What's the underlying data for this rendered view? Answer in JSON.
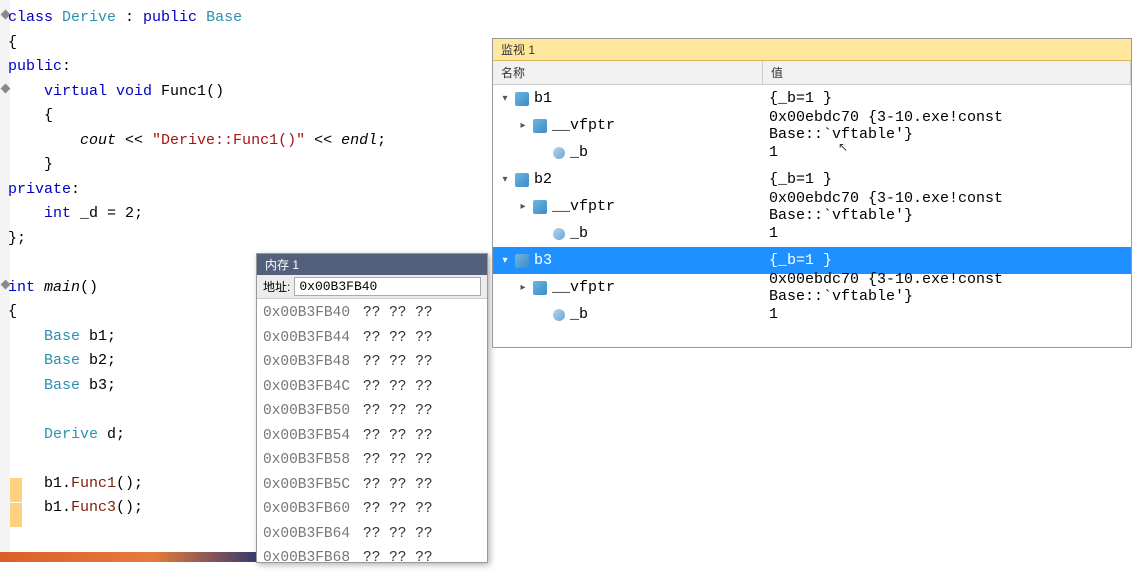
{
  "code": {
    "lines": [
      {
        "seg": [
          {
            "t": "class ",
            "c": "kw"
          },
          {
            "t": "Derive",
            "c": "type"
          },
          {
            "t": " : "
          },
          {
            "t": "public ",
            "c": "kw"
          },
          {
            "t": "Base",
            "c": "type"
          }
        ]
      },
      {
        "seg": [
          {
            "t": "{"
          }
        ]
      },
      {
        "seg": [
          {
            "t": "public",
            "c": "kw"
          },
          {
            "t": ":"
          }
        ]
      },
      {
        "seg": [
          {
            "t": "    "
          },
          {
            "t": "virtual void ",
            "c": "kw"
          },
          {
            "t": "Func1",
            "c": ""
          },
          {
            "t": "()"
          }
        ]
      },
      {
        "seg": [
          {
            "t": "    {"
          }
        ]
      },
      {
        "seg": [
          {
            "t": "        "
          },
          {
            "t": "cout",
            "c": "it"
          },
          {
            "t": " << "
          },
          {
            "t": "\"Derive::Func1()\"",
            "c": "str"
          },
          {
            "t": " << "
          },
          {
            "t": "endl",
            "c": "it"
          },
          {
            "t": ";"
          }
        ]
      },
      {
        "seg": [
          {
            "t": "    }"
          }
        ]
      },
      {
        "seg": [
          {
            "t": "private",
            "c": "kw"
          },
          {
            "t": ":"
          }
        ]
      },
      {
        "seg": [
          {
            "t": "    "
          },
          {
            "t": "int ",
            "c": "kw"
          },
          {
            "t": "_d = "
          },
          {
            "t": "2",
            "c": ""
          },
          {
            "t": ";"
          }
        ]
      },
      {
        "seg": [
          {
            "t": "};"
          }
        ]
      },
      {
        "seg": [
          {
            "t": ""
          }
        ]
      },
      {
        "seg": [
          {
            "t": "int ",
            "c": "kw"
          },
          {
            "t": "main",
            "c": "it"
          },
          {
            "t": "()"
          }
        ]
      },
      {
        "seg": [
          {
            "t": "{"
          }
        ]
      },
      {
        "seg": [
          {
            "t": "    "
          },
          {
            "t": "Base",
            "c": "type"
          },
          {
            "t": " b1;"
          }
        ]
      },
      {
        "seg": [
          {
            "t": "    "
          },
          {
            "t": "Base",
            "c": "type"
          },
          {
            "t": " b2;"
          }
        ]
      },
      {
        "seg": [
          {
            "t": "    "
          },
          {
            "t": "Base",
            "c": "type"
          },
          {
            "t": " b3;"
          }
        ]
      },
      {
        "seg": [
          {
            "t": ""
          }
        ]
      },
      {
        "seg": [
          {
            "t": "    "
          },
          {
            "t": "Derive",
            "c": "type"
          },
          {
            "t": " d;"
          }
        ]
      },
      {
        "seg": [
          {
            "t": ""
          }
        ]
      },
      {
        "seg": [
          {
            "t": "    b1."
          },
          {
            "t": "Func1",
            "c": "func"
          },
          {
            "t": "();"
          }
        ]
      },
      {
        "seg": [
          {
            "t": "    b1."
          },
          {
            "t": "Func3",
            "c": "func"
          },
          {
            "t": "();"
          }
        ]
      }
    ]
  },
  "memory": {
    "title": "内存 1",
    "addr_label": "地址:",
    "addr_value": "0x00B3FB40",
    "rows": [
      {
        "addr": "0x00B3FB40",
        "bytes": "?? ?? ??"
      },
      {
        "addr": "0x00B3FB44",
        "bytes": "?? ?? ??"
      },
      {
        "addr": "0x00B3FB48",
        "bytes": "?? ?? ??"
      },
      {
        "addr": "0x00B3FB4C",
        "bytes": "?? ?? ??"
      },
      {
        "addr": "0x00B3FB50",
        "bytes": "?? ?? ??"
      },
      {
        "addr": "0x00B3FB54",
        "bytes": "?? ?? ??"
      },
      {
        "addr": "0x00B3FB58",
        "bytes": "?? ?? ??"
      },
      {
        "addr": "0x00B3FB5C",
        "bytes": "?? ?? ??"
      },
      {
        "addr": "0x00B3FB60",
        "bytes": "?? ?? ??"
      },
      {
        "addr": "0x00B3FB64",
        "bytes": "?? ?? ??"
      },
      {
        "addr": "0x00B3FB68",
        "bytes": "?? ?? ??"
      }
    ]
  },
  "watch": {
    "title": "监视 1",
    "col_name": "名称",
    "col_value": "值",
    "rows": [
      {
        "indent": 0,
        "toggle": "▾",
        "icon": "struct",
        "name": "b1",
        "value": "{_b=1 }",
        "selected": false
      },
      {
        "indent": 1,
        "toggle": "▸",
        "icon": "struct",
        "name": "__vfptr",
        "value": "0x00ebdc70 {3-10.exe!const Base::`vftable'}",
        "selected": false
      },
      {
        "indent": 2,
        "toggle": "",
        "icon": "field",
        "name": "_b",
        "value": "1",
        "selected": false
      },
      {
        "indent": 0,
        "toggle": "▾",
        "icon": "struct",
        "name": "b2",
        "value": "{_b=1 }",
        "selected": false
      },
      {
        "indent": 1,
        "toggle": "▸",
        "icon": "struct",
        "name": "__vfptr",
        "value": "0x00ebdc70 {3-10.exe!const Base::`vftable'}",
        "selected": false
      },
      {
        "indent": 2,
        "toggle": "",
        "icon": "field",
        "name": "_b",
        "value": "1",
        "selected": false
      },
      {
        "indent": 0,
        "toggle": "▾",
        "icon": "struct",
        "name": "b3",
        "value": "{_b=1 }",
        "selected": true
      },
      {
        "indent": 1,
        "toggle": "▸",
        "icon": "struct",
        "name": "__vfptr",
        "value": "0x00ebdc70 {3-10.exe!const Base::`vftable'}",
        "selected": false
      },
      {
        "indent": 2,
        "toggle": "",
        "icon": "field",
        "name": "_b",
        "value": "1",
        "selected": false
      }
    ]
  }
}
